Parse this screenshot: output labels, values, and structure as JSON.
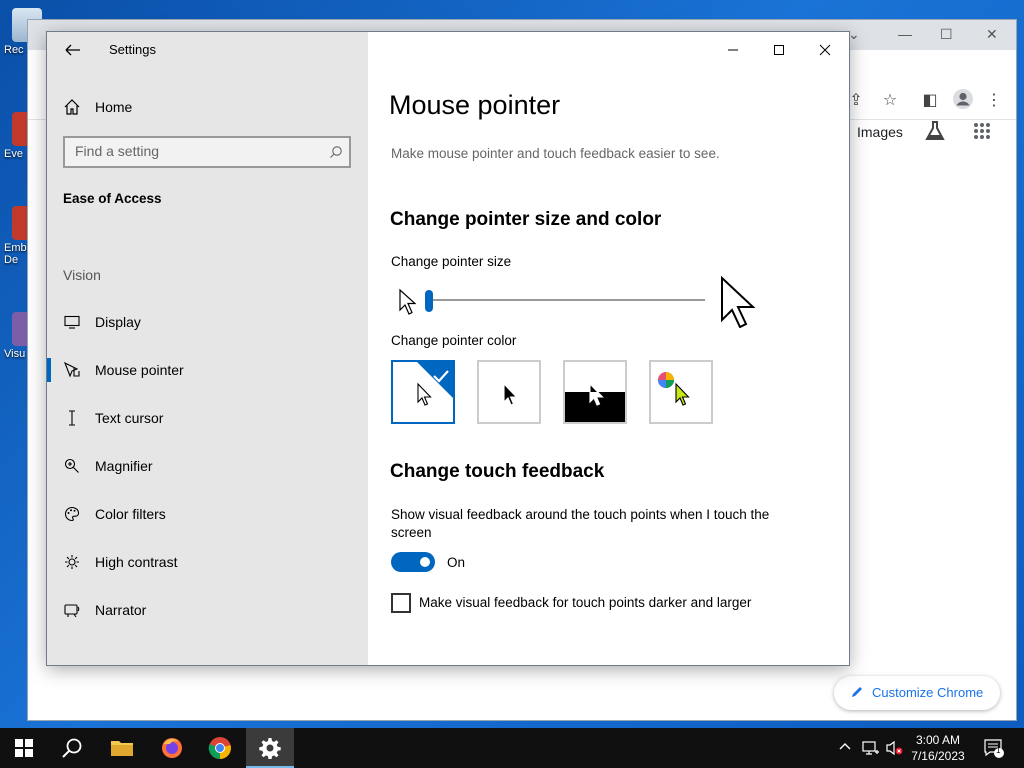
{
  "desktop": {
    "icons": [
      {
        "label": "Rec",
        "icon": "recycle-bin-icon"
      },
      {
        "label": "Eve",
        "icon": "shortcut-icon"
      },
      {
        "label": "Emb",
        "label2": "De",
        "icon": "shortcut-icon"
      },
      {
        "label": "Visu",
        "icon": "visual-studio-icon"
      }
    ]
  },
  "chrome": {
    "images_link": "Images",
    "customize_label": "Customize Chrome"
  },
  "settings": {
    "window_title": "Settings",
    "home_label": "Home",
    "search_placeholder": "Find a setting",
    "section_heading": "Ease of Access",
    "group_heading": "Vision",
    "nav_items": [
      {
        "label": "Display",
        "icon": "display-icon"
      },
      {
        "label": "Mouse pointer",
        "icon": "mouse-pointer-icon",
        "selected": true
      },
      {
        "label": "Text cursor",
        "icon": "text-cursor-icon"
      },
      {
        "label": "Magnifier",
        "icon": "magnifier-icon"
      },
      {
        "label": "Color filters",
        "icon": "color-filters-icon"
      },
      {
        "label": "High contrast",
        "icon": "high-contrast-icon"
      },
      {
        "label": "Narrator",
        "icon": "narrator-icon"
      }
    ],
    "page_title": "Mouse pointer",
    "page_description": "Make mouse pointer and touch feedback easier to see.",
    "pointer_heading": "Change pointer size and color",
    "size_label": "Change pointer size",
    "size_level": 0.01,
    "color_label": "Change pointer color",
    "color_options": [
      {
        "name": "white",
        "selected": true
      },
      {
        "name": "black",
        "selected": false
      },
      {
        "name": "inverted",
        "selected": false
      },
      {
        "name": "custom",
        "selected": false
      }
    ],
    "touch_heading": "Change touch feedback",
    "touch_description": "Show visual feedback around the touch points when I touch the screen",
    "touch_toggle_state": "On",
    "darker_checkbox_label": "Make visual feedback for touch points darker and larger",
    "darker_checked": false
  },
  "taskbar": {
    "time": "3:00 AM",
    "date": "7/16/2023",
    "notification_count": "1"
  },
  "colors": {
    "accent": "#0067c0",
    "sidebar_bg": "#e6e6e6",
    "taskbar_bg": "#101010",
    "chrome_link": "#1a73e8"
  }
}
